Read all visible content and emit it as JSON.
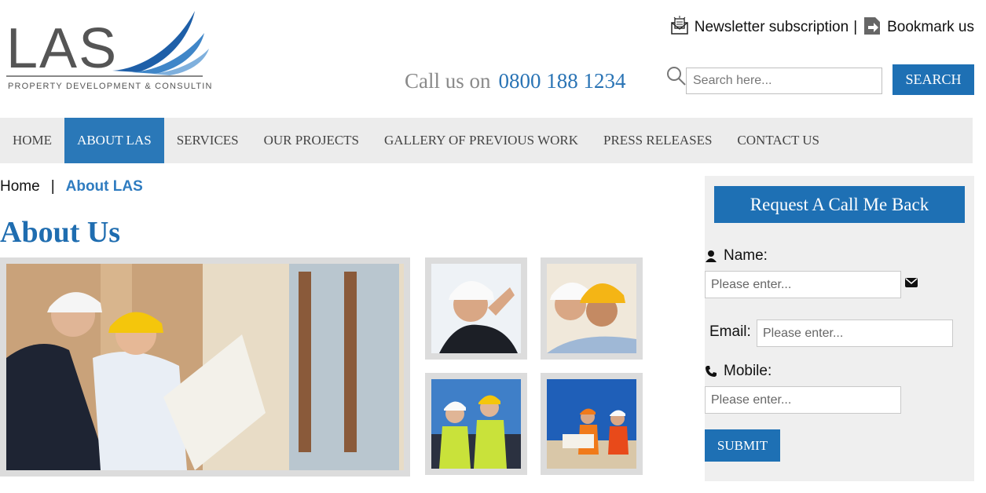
{
  "brand": {
    "logo_text": "LAS",
    "logo_tagline": "PROPERTY DEVELOPMENT & CONSULTING",
    "primary_color": "#1e70b4",
    "accent_color": "#2a78b8"
  },
  "toplinks": {
    "newsletter_label": "Newsletter subscription",
    "separator": "|",
    "bookmark_label": "Bookmark us"
  },
  "callus": {
    "label": "Call us on",
    "number": "0800 188 1234"
  },
  "search": {
    "placeholder": "Search here...",
    "button_label": "SEARCH"
  },
  "nav": {
    "items": [
      {
        "label": "HOME"
      },
      {
        "label": "ABOUT LAS",
        "active": true
      },
      {
        "label": "SERVICES"
      },
      {
        "label": "OUR PROJECTS"
      },
      {
        "label": "GALLERY OF PREVIOUS WORK"
      },
      {
        "label": "PRESS RELEASES"
      },
      {
        "label": "CONTACT US"
      }
    ]
  },
  "breadcrumb": {
    "home": "Home",
    "separator": "|",
    "current": "About LAS"
  },
  "page": {
    "title": "About Us"
  },
  "form": {
    "heading": "Request A Call Me Back",
    "name_label": "Name:",
    "name_placeholder": "Please enter...",
    "email_label": "Email:",
    "email_placeholder": "Please enter...",
    "mobile_label": "Mobile:",
    "mobile_placeholder": "Please enter...",
    "submit_label": "SUBMIT"
  },
  "icons": {
    "newsletter": "newsletter-icon",
    "bookmark": "bookmark-icon",
    "search": "search-icon",
    "user": "user-icon",
    "envelope": "envelope-icon",
    "phone": "phone-icon"
  }
}
